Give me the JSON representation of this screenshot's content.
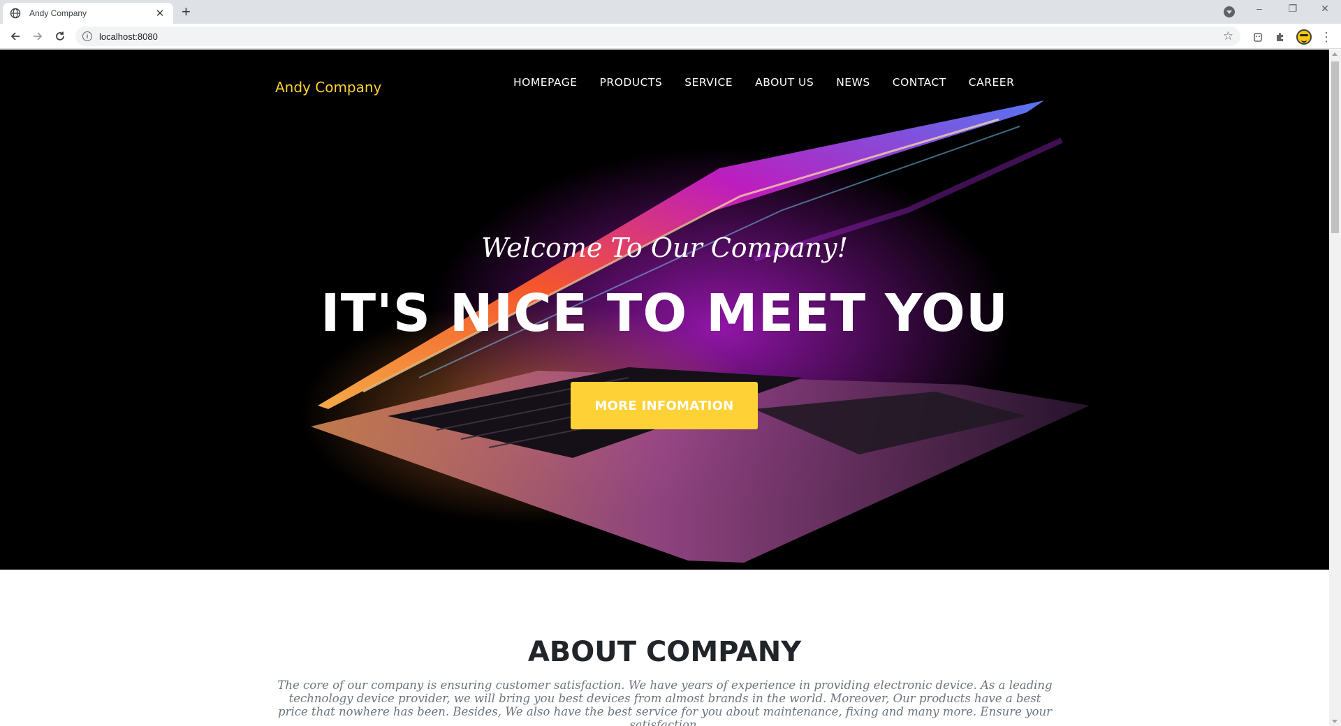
{
  "browser": {
    "tab_title": "Andy Company",
    "new_tab": "+",
    "close": "✕",
    "url": "localhost:8080",
    "window_controls": [
      "–",
      "❐",
      "✕"
    ]
  },
  "site": {
    "brand": "Andy Company",
    "nav": [
      "HOMEPAGE",
      "PRODUCTS",
      "SERVICE",
      "ABOUT US",
      "NEWS",
      "CONTACT",
      "CAREER"
    ],
    "hero": {
      "subtitle": "Welcome To Our Company!",
      "title": "IT'S NICE TO MEET YOU",
      "cta": "MORE INFOMATION"
    },
    "about": {
      "title": "ABOUT COMPANY",
      "text": "The core of our company is ensuring customer satisfaction. We have years of experience in providing electronic device. As a leading technology device provider, we will bring you best devices from almost brands in the world. Moreover, Our products have a best price that nowhere has been. Besides, We also have the best service for you about maintenance, fixing and many more. Ensure your satisfaction."
    }
  },
  "colors": {
    "accent": "#fed136",
    "hero_bg": "#000000",
    "heading": "#212529",
    "muted": "#6c757d"
  }
}
